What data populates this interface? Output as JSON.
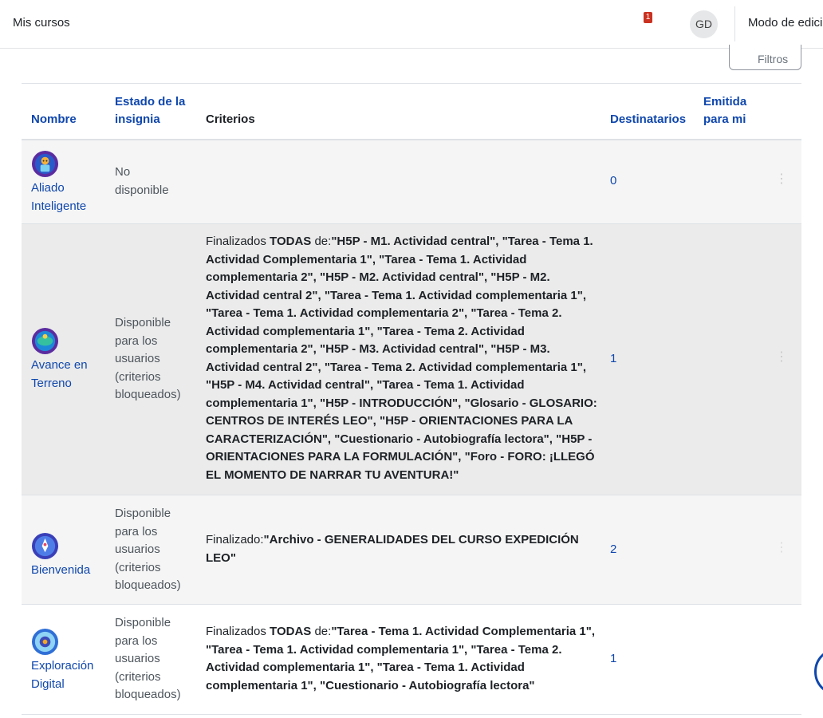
{
  "navbar": {
    "my_courses": "Mis cursos",
    "notification_count": "1",
    "avatar_initials": "GD",
    "edit_mode": "Modo de edici"
  },
  "filters": {
    "label": "Filtros"
  },
  "table": {
    "headers": {
      "name": "Nombre",
      "status_line1": "Estado de la",
      "status_line2": "insignia",
      "criteria": "Criterios",
      "recipients": "Destinatarios",
      "issued_line1": "Emitida",
      "issued_line2": "para mi"
    },
    "rows": [
      {
        "name_line1": "Aliado",
        "name_line2": "Inteligente",
        "status_line1": "No",
        "status_line2": "disponible",
        "recipients": "0",
        "icon": "robot-badge-icon"
      },
      {
        "name_line1": "Avance en",
        "name_line2": "Terreno",
        "status_lines": [
          "Disponible",
          "para los",
          "usuarios",
          "(criterios",
          "bloqueados)"
        ],
        "criteria_prefix": "Finalizados ",
        "criteria_all": "TODAS",
        "criteria_de": " de:",
        "criteria_items": "\"H5P - M1. Actividad central\", \"Tarea - Tema 1. Actividad Complementaria 1\", \"Tarea - Tema 1. Actividad complementaria 2\", \"H5P - M2. Actividad central\", \"H5P - M2. Actividad central 2\", \"Tarea - Tema 1. Actividad complementaria 1\", \"Tarea - Tema 1. Actividad complementaria 2\", \"Tarea - Tema 2. Actividad complementaria 1\", \"Tarea - Tema 2. Actividad complementaria 2\", \"H5P - M3. Actividad central\", \"H5P - M3. Actividad central 2\", \"Tarea - Tema 2. Actividad complementaria 1\", \"H5P - M4. Actividad central\", \"Tarea - Tema 1. Actividad complementaria 1\", \"H5P - INTRODUCCIÓN\", \"Glosario - GLOSARIO: CENTROS DE INTERÉS LEO\", \"H5P - ORIENTACIONES PARA LA CARACTERIZACIÓN\", \"Cuestionario - Autobiografía lectora\", \"H5P - ORIENTACIONES PARA LA FORMULACIÓN\", \"Foro - FORO: ¡LLEGÓ EL MOMENTO DE NARRAR TU AVENTURA!\"",
        "recipients": "1",
        "icon": "globe-badge-icon"
      },
      {
        "name_line1": "Bienvenida",
        "status_lines": [
          "Disponible",
          "para los",
          "usuarios",
          "(criterios",
          "bloqueados)"
        ],
        "criteria_prefix": "Finalizado:",
        "criteria_items": "\"Archivo - GENERALIDADES DEL CURSO EXPEDICIÓN LEO\"",
        "recipients": "2",
        "icon": "rocket-badge-icon"
      },
      {
        "name_line1": "Exploración",
        "name_line2": "Digital",
        "status_lines": [
          "Disponible",
          "para los",
          "usuarios",
          "(criterios",
          "bloqueados)"
        ],
        "criteria_prefix": "Finalizados ",
        "criteria_all": "TODAS",
        "criteria_de": " de:",
        "criteria_items": "\"Tarea - Tema 1. Actividad Complementaria 1\", \"Tarea - Tema 1. Actividad complementaria 1\", \"Tarea - Tema 2. Actividad complementaria 1\", \"Tarea - Tema 1. Actividad complementaria 1\", \"Cuestionario - Autobiografía lectora\"",
        "recipients": "1",
        "icon": "digital-badge-icon"
      }
    ]
  },
  "colors": {
    "link": "#0f47ad",
    "notification": "#ca3120",
    "row_shade": "#f5f5f5",
    "row_hover": "#ebebeb"
  }
}
